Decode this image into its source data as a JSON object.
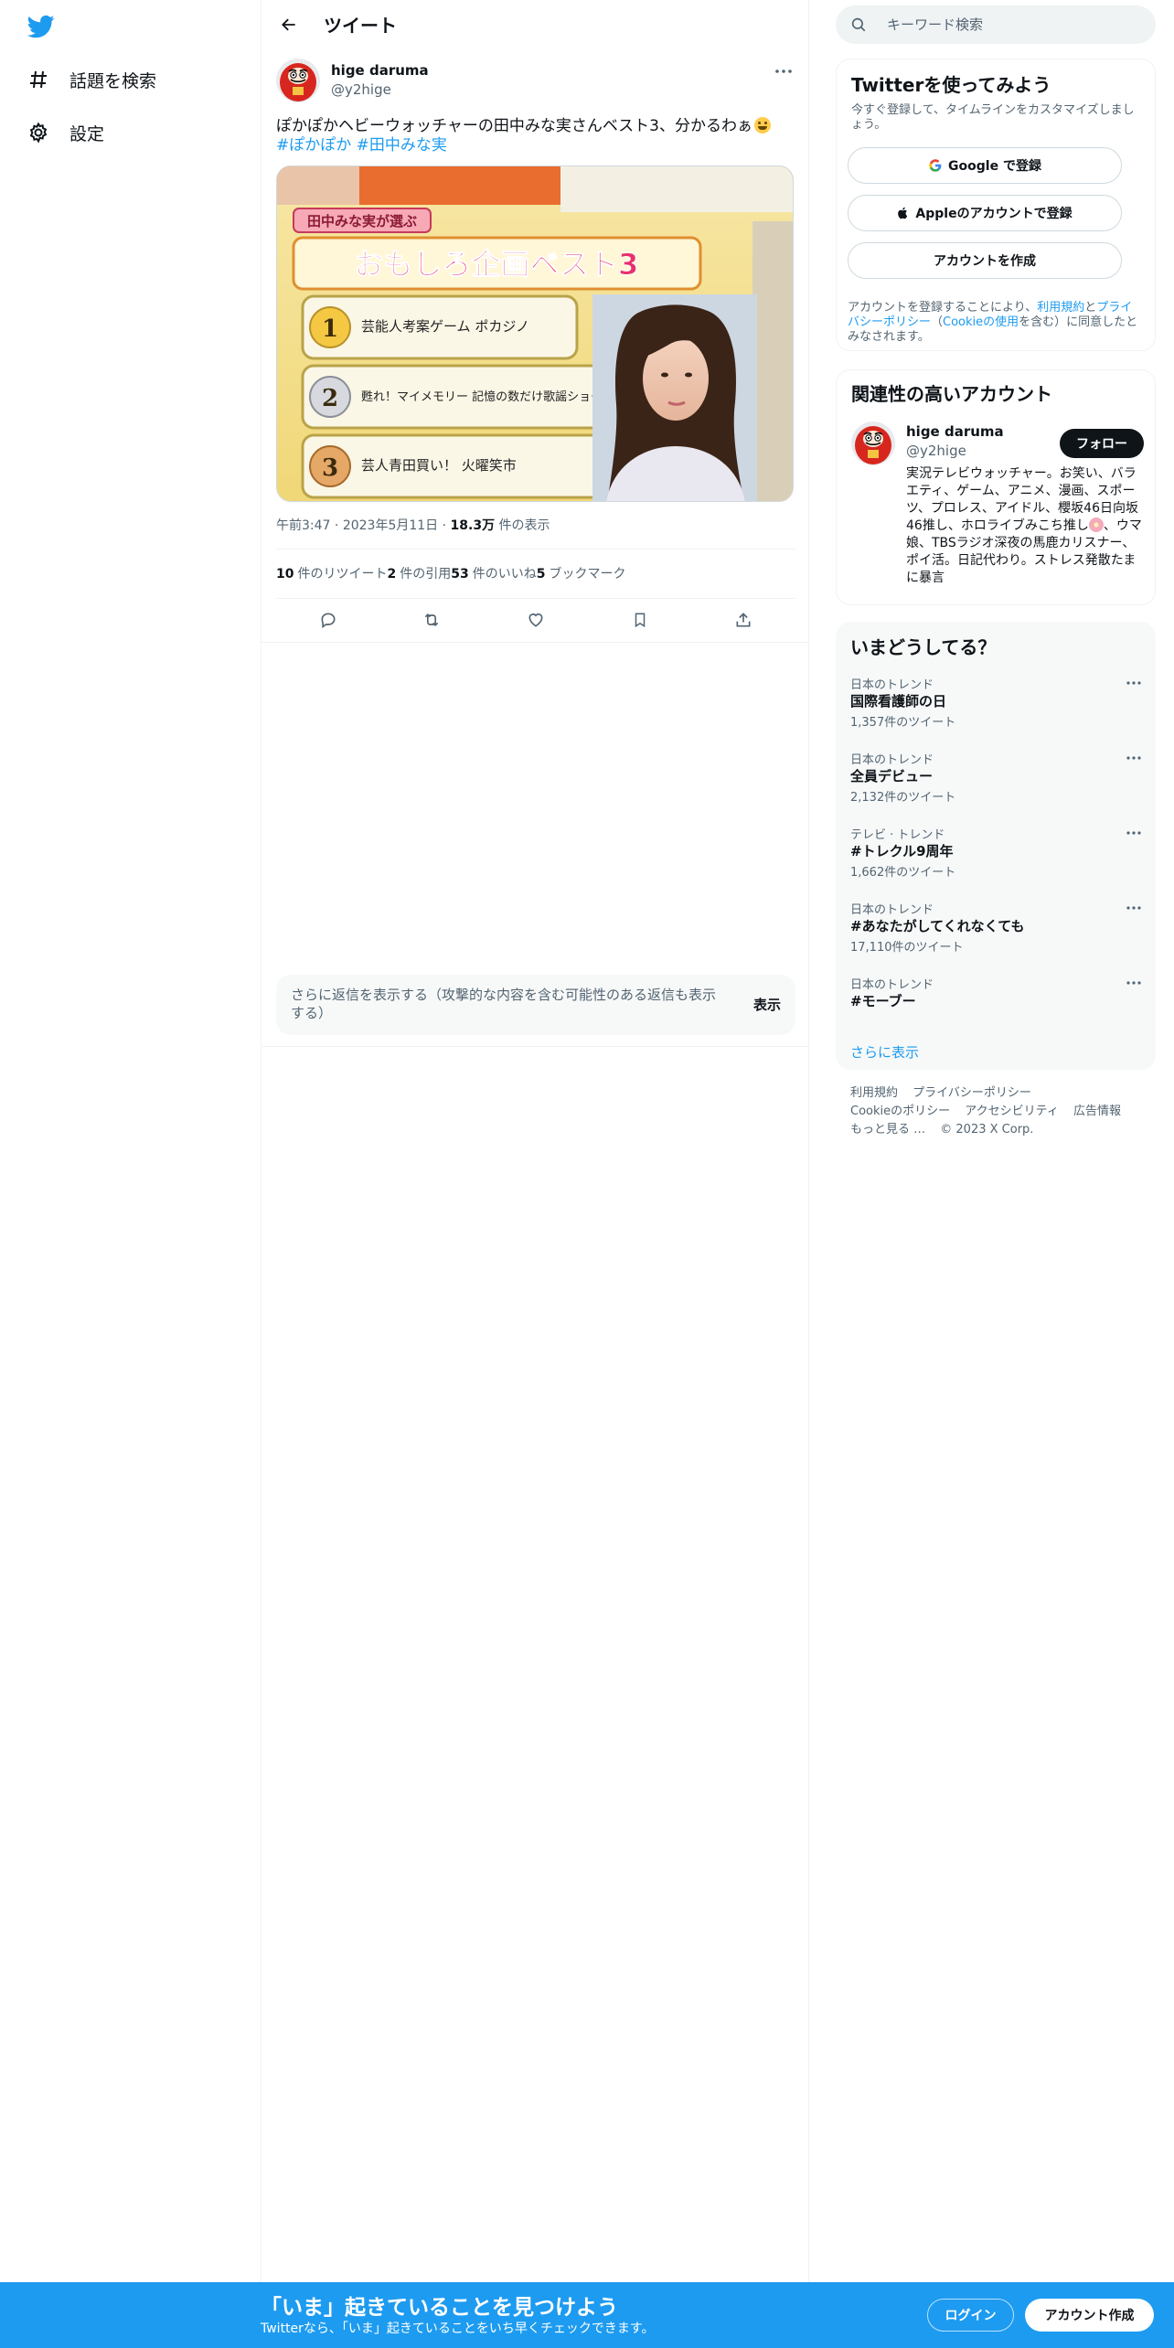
{
  "colors": {
    "accent": "#1d9bf0",
    "text": "#0f1419",
    "muted": "#536471",
    "border": "#eff3f4",
    "panel": "#f7f9f9"
  },
  "leftnav": {
    "logo_icon": "twitter-bird-icon",
    "items": [
      {
        "label": "話題を検索",
        "icon": "hashtag-icon"
      },
      {
        "label": "設定",
        "icon": "gear-icon"
      }
    ]
  },
  "header": {
    "title": "ツイート",
    "back_icon": "arrow-left-icon"
  },
  "tweet": {
    "author_name": "hige daruma",
    "author_handle": "@y2hige",
    "text": "ぽかぽかヘビーウォッチャーの田中みな実さんベスト3、分かるわぁ",
    "hashtags": "#ぽかぽか #田中みな実",
    "image_overlay_text": {
      "title": "おもしろ企画ベスト3",
      "subtitle": "田中みな実が選ぶ",
      "item1": "芸能人考案ゲーム ポカジノ",
      "item2": "甦れ！マイメモリー 記憶の数だけ歌謡ショー",
      "item3": "芸人青田買い！ 火曜笑市"
    },
    "time": "午前3:47",
    "date": "2023年5月11日",
    "views_count": "18.3万",
    "views_label": "件の表示",
    "stats": [
      {
        "count": "10",
        "label": "件のリツイート"
      },
      {
        "count": "2",
        "label": "件の引用"
      },
      {
        "count": "53",
        "label": "件のいいね"
      },
      {
        "count": "5",
        "label": "ブックマーク"
      }
    ]
  },
  "more_replies": {
    "text": "さらに返信を表示する（攻撃的な内容を含む可能性のある返信も表示する）",
    "button": "表示"
  },
  "search": {
    "placeholder": "キーワード検索"
  },
  "signup_card": {
    "title": "Twitterを使ってみよう",
    "subtitle": "今すぐ登録して、タイムラインをカスタマイズしましょう。",
    "google_button": "Google で登録",
    "apple_button": "Appleのアカウントで登録",
    "create_button": "アカウントを作成",
    "terms_pre": "アカウントを登録することにより、",
    "terms_link1": "利用規約",
    "terms_mid1": "と",
    "terms_link2": "プライバシーポリシー",
    "terms_mid2": "（",
    "terms_link3": "Cookieの使用",
    "terms_post": "を含む）に同意したとみなされます。"
  },
  "related": {
    "title": "関連性の高いアカウント",
    "name": "hige daruma",
    "handle": "@y2hige",
    "follow_button": "フォロー",
    "bio_pre": "実況テレビウォッチャー。お笑い、バラエティ、ゲーム、アニメ、漫画、スポーツ、プロレス、アイドル、櫻坂46日向坂46推し、ホロライブみこち推し",
    "bio_post": "、ウマ娘、TBSラジオ深夜の馬鹿カリスナー、ポイ活。日記代わり。ストレス発散たまに暴言"
  },
  "trends": {
    "title": "いまどうしてる？",
    "items": [
      {
        "category": "日本のトレンド",
        "name": "国際看護師の日",
        "count": "1,357件のツイート"
      },
      {
        "category": "日本のトレンド",
        "name": "全員デビュー",
        "count": "2,132件のツイート"
      },
      {
        "category": "テレビ · トレンド",
        "name": "#トレクル9周年",
        "count": "1,662件のツイート"
      },
      {
        "category": "日本のトレンド",
        "name": "#あなたがしてくれなくても",
        "count": "17,110件のツイート"
      },
      {
        "category": "日本のトレンド",
        "name": "#モーブー",
        "count": ""
      }
    ],
    "show_more": "さらに表示"
  },
  "footer": {
    "links": [
      "利用規約",
      "プライバシーポリシー",
      "Cookieのポリシー",
      "アクセシビリティ",
      "広告情報",
      "もっと見る …"
    ],
    "copyright": "© 2023 X Corp."
  },
  "bottom_bar": {
    "title": "「いま」起きていることを見つけよう",
    "subtitle": "Twitterなら、「いま」起きていることをいち早くチェックできます。",
    "login": "ログイン",
    "signup": "アカウント作成"
  }
}
